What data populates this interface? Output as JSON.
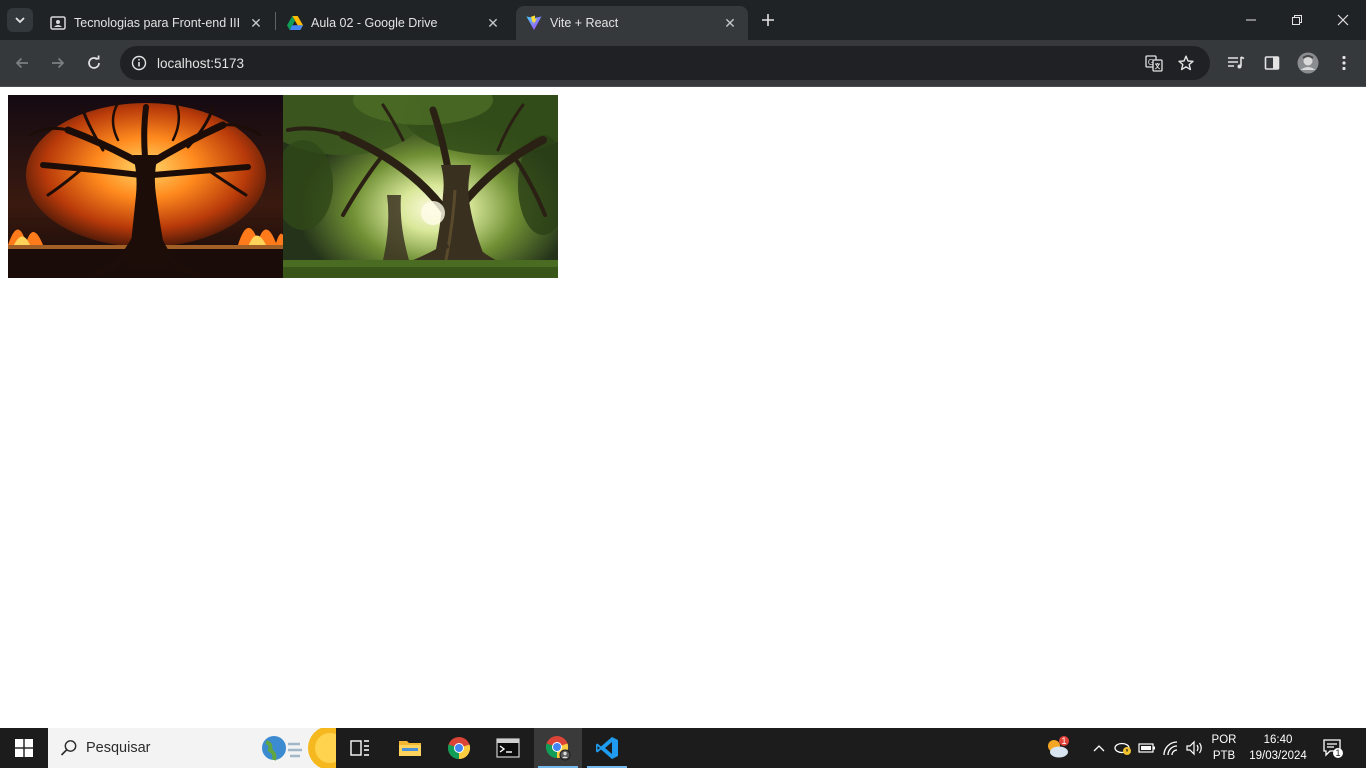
{
  "tabs": [
    {
      "title": "Tecnologias para Front-end III",
      "active": false
    },
    {
      "title": "Aula 02 - Google Drive",
      "active": false
    },
    {
      "title": "Vite + React",
      "active": true
    }
  ],
  "address_bar": {
    "url": "localhost:5173"
  },
  "page": {
    "images": [
      {
        "subject": "burning tree"
      },
      {
        "subject": "large tree in green forest"
      }
    ]
  },
  "taskbar": {
    "search_placeholder": "Pesquisar",
    "apps": [
      "task-view",
      "file-explorer",
      "chrome",
      "terminal",
      "chrome-profile",
      "vscode"
    ],
    "weather_badge": "1",
    "language_line1": "POR",
    "language_line2": "PTB",
    "time": "16:40",
    "date": "19/03/2024",
    "notifications_count": "1"
  },
  "colors": {
    "chrome_dark": "#1f2326",
    "toolbar": "#35393c",
    "taskbar": "#1c1c1c",
    "accent": "#76b9ed"
  }
}
